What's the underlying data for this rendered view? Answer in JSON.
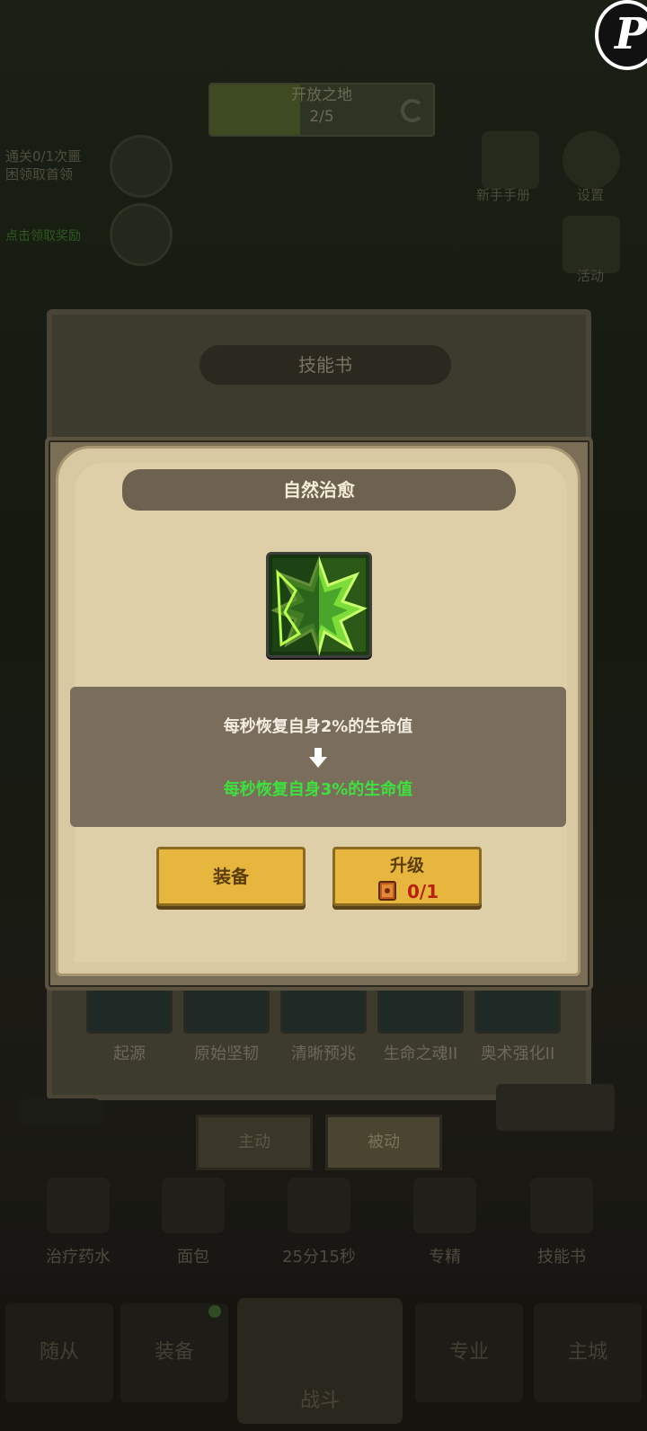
{
  "background": {
    "stage": {
      "name": "开放之地",
      "progress": "2/5"
    },
    "quest": {
      "line1": "通关0/1次噩",
      "line2": "困领取首领",
      "green_text": "点击领取奖励"
    },
    "side_menu": [
      {
        "label": "新手手册",
        "icon": "book-icon"
      },
      {
        "label": "设置",
        "icon": "gear-icon"
      },
      {
        "label": "活动",
        "icon": "calendar-icon"
      }
    ],
    "skill_book_title": "技能书",
    "skills": [
      "起源",
      "原始坚韧",
      "清晰预兆",
      "生命之魂II",
      "奥术强化II"
    ],
    "tabs": {
      "active": "主动",
      "passive": "被动"
    },
    "bottom_items": [
      "治疗药水",
      "面包",
      "25分15秒",
      "专精",
      "技能书"
    ],
    "nav": {
      "companion": "随从",
      "equipment": "装备",
      "battle": "战斗",
      "profession": "专业",
      "city": "主城"
    }
  },
  "modal": {
    "title": "自然治愈",
    "skill_icon": "nature-heal-icon",
    "current_effect": "每秒恢复自身2%的生命值",
    "next_effect": "每秒恢复自身3%的生命值",
    "next_effect_color": "#3ee03e",
    "equip_label": "装备",
    "upgrade_label": "升级",
    "upgrade_cost": "0/1",
    "upgrade_cost_color": "#b82010",
    "accent_yellow": "#e7b63f"
  }
}
